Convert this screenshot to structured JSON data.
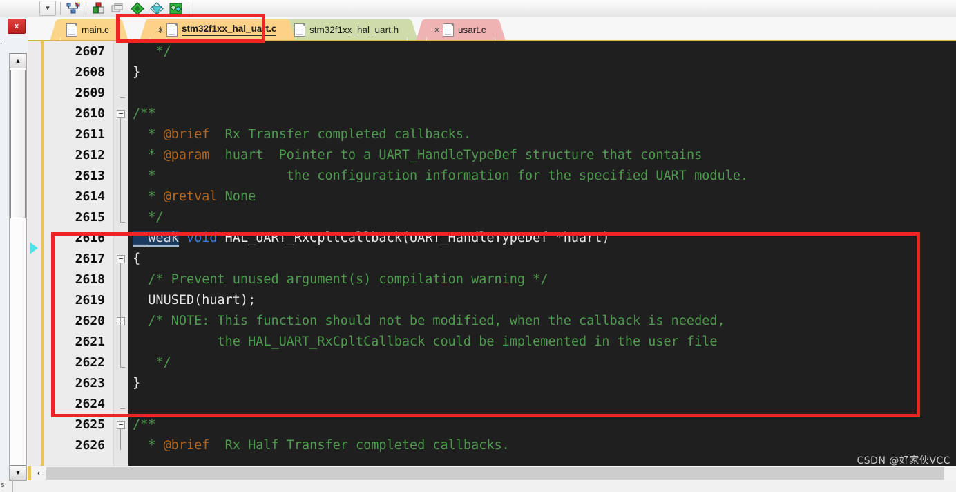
{
  "toolbar": {
    "buttons": [
      {
        "name": "dropdown-chevron",
        "glyph": "⌄"
      },
      {
        "name": "magic-wand",
        "glyph": ""
      },
      {
        "name": "build-target",
        "glyph": ""
      },
      {
        "name": "manage-windows",
        "glyph": ""
      },
      {
        "name": "green-diamond",
        "glyph": ""
      },
      {
        "name": "white-diamond",
        "glyph": ""
      },
      {
        "name": "multi-diamond",
        "glyph": ""
      }
    ]
  },
  "left_panel": {
    "close_label": "x",
    "scroll_up": "▲",
    "scroll_down": "▼",
    "bottom_text": "s"
  },
  "tabs": [
    {
      "label": "main.c",
      "icon": "document-icon",
      "modified": false,
      "active": false
    },
    {
      "label": "stm32f1xx_hal_uart.c",
      "icon": "document-modified-icon",
      "modified": true,
      "active": true
    },
    {
      "label": "stm32f1xx_hal_uart.h",
      "icon": "document-icon",
      "modified": false,
      "active": false
    },
    {
      "label": "usart.c",
      "icon": "document-modified-icon",
      "modified": true,
      "active": false
    }
  ],
  "editor": {
    "first_line": 2607,
    "lines": [
      {
        "num": "2607",
        "fold": "",
        "html": "<span class='cmt'>   */</span>"
      },
      {
        "num": "2608",
        "fold": "",
        "html": "}"
      },
      {
        "num": "2609",
        "fold": "tick",
        "html": ""
      },
      {
        "num": "2610",
        "fold": "minus",
        "html": "<span class='cmt'>/**</span>"
      },
      {
        "num": "2611",
        "fold": "",
        "html": "<span class='cmt'>  * </span><span class='tag'>@brief</span><span class='cmt'>  Rx Transfer completed callbacks.</span>"
      },
      {
        "num": "2612",
        "fold": "",
        "html": "<span class='cmt'>  * </span><span class='tag'>@param</span><span class='cmt'>  huart  Pointer to a UART_HandleTypeDef structure that contains</span>"
      },
      {
        "num": "2613",
        "fold": "",
        "html": "<span class='cmt'>  *                 the configuration information for the specified UART module.</span>"
      },
      {
        "num": "2614",
        "fold": "",
        "html": "<span class='cmt'>  * </span><span class='tag'>@retval</span><span class='cmt'> None</span>"
      },
      {
        "num": "2615",
        "fold": "tick",
        "html": "<span class='cmt'>  */</span>"
      },
      {
        "num": "2616",
        "fold": "",
        "html": "<span class='weak'>__weak</span> <span class='kw'>void</span> HAL_UART_RxCpltCallback(UART_HandleTypeDef *huart)"
      },
      {
        "num": "2617",
        "fold": "minus",
        "html": "{"
      },
      {
        "num": "2618",
        "fold": "",
        "html": "  <span class='cmt'>/* Prevent unused argument(s) compilation warning */</span>"
      },
      {
        "num": "2619",
        "fold": "",
        "html": "  UNUSED(huart);"
      },
      {
        "num": "2620",
        "fold": "minus",
        "html": "  <span class='cmt'>/* NOTE: This function should not be modified, when the callback is needed,</span>"
      },
      {
        "num": "2621",
        "fold": "",
        "html": "<span class='cmt'>           the HAL_UART_RxCpltCallback could be implemented in the user file</span>"
      },
      {
        "num": "2622",
        "fold": "tick",
        "html": "<span class='cmt'>   */</span>"
      },
      {
        "num": "2623",
        "fold": "",
        "html": "}"
      },
      {
        "num": "2624",
        "fold": "tick",
        "html": ""
      },
      {
        "num": "2625",
        "fold": "minus",
        "html": "<span class='cmt'>/**</span>"
      },
      {
        "num": "2626",
        "fold": "",
        "html": "<span class='cmt'>  * </span><span class='tag'>@brief</span><span class='cmt'>  Rx Half Transfer completed callbacks.</span>"
      }
    ]
  },
  "hscroll": {
    "left_arrow": "‹"
  },
  "annotations": {
    "color": "#ef2525",
    "box_tab": "highlight-active-tab",
    "box_code": "highlight-callback-function"
  },
  "watermark": "CSDN @好家伙VCC"
}
